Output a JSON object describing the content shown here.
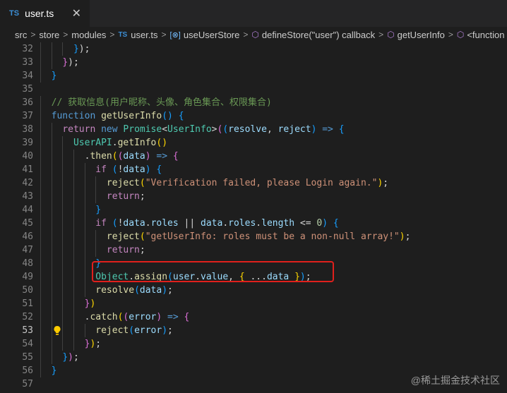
{
  "tab": {
    "badge": "TS",
    "label": "user.ts",
    "close_glyph": "✕"
  },
  "breadcrumb": {
    "items": [
      "src",
      "store",
      "modules",
      "user.ts",
      "useUserStore",
      "defineStore(\"user\") callback",
      "getUserInfo",
      "<function"
    ],
    "ts_badge": "TS",
    "var_icon": "[⊗]",
    "cube_icon": "⬡"
  },
  "colors": {
    "keyword": "#569cd6",
    "control": "#c586c0",
    "function": "#dcdcaa",
    "type": "#4ec9b0",
    "variable": "#9cdcfe",
    "string": "#ce9178",
    "number": "#b5cea8",
    "comment": "#6a9955",
    "highlight": "#e0201c"
  },
  "editor": {
    "active_line": 53,
    "lightbulb_icon": "lightbulb-icon",
    "lines": [
      {
        "n": "32",
        "t": [
          [
            "      ",
            "pn"
          ],
          [
            "}",
            "b3"
          ],
          [
            ");",
            "pn"
          ]
        ]
      },
      {
        "n": "33",
        "t": [
          [
            "    ",
            "pn"
          ],
          [
            "}",
            "b2"
          ],
          [
            ");",
            "pn"
          ]
        ]
      },
      {
        "n": "34",
        "t": [
          [
            "  ",
            "pn"
          ],
          [
            "}",
            "b3"
          ]
        ]
      },
      {
        "n": "35",
        "t": []
      },
      {
        "n": "36",
        "t": [
          [
            "  ",
            "pn"
          ],
          [
            "// 获取信息(用户昵称、头像、角色集合、权限集合)",
            "cm"
          ]
        ]
      },
      {
        "n": "37",
        "t": [
          [
            "  ",
            "pn"
          ],
          [
            "function",
            "kw"
          ],
          [
            " ",
            "pn"
          ],
          [
            "getUserInfo",
            "fn"
          ],
          [
            "()",
            "b3"
          ],
          [
            " ",
            "pn"
          ],
          [
            "{",
            "b3"
          ]
        ]
      },
      {
        "n": "38",
        "t": [
          [
            "    ",
            "pn"
          ],
          [
            "return",
            "ctl"
          ],
          [
            " ",
            "pn"
          ],
          [
            "new",
            "kw"
          ],
          [
            " ",
            "pn"
          ],
          [
            "Promise",
            "ty"
          ],
          [
            "<",
            "pn"
          ],
          [
            "UserInfo",
            "ty"
          ],
          [
            ">",
            "pn"
          ],
          [
            "(",
            "b2"
          ],
          [
            "(",
            "b3"
          ],
          [
            "resolve",
            "vr"
          ],
          [
            ", ",
            "pn"
          ],
          [
            "reject",
            "vr"
          ],
          [
            ")",
            "b3"
          ],
          [
            " => ",
            "kw"
          ],
          [
            "{",
            "b3"
          ]
        ]
      },
      {
        "n": "39",
        "t": [
          [
            "      ",
            "pn"
          ],
          [
            "UserAPI",
            "ty"
          ],
          [
            ".",
            "pn"
          ],
          [
            "getInfo",
            "fn"
          ],
          [
            "()",
            "b1"
          ]
        ]
      },
      {
        "n": "40",
        "t": [
          [
            "        .",
            "pn"
          ],
          [
            "then",
            "fn"
          ],
          [
            "(",
            "b1"
          ],
          [
            "(",
            "b2"
          ],
          [
            "data",
            "vr"
          ],
          [
            ")",
            "b2"
          ],
          [
            " => ",
            "kw"
          ],
          [
            "{",
            "b2"
          ]
        ]
      },
      {
        "n": "41",
        "t": [
          [
            "          ",
            "pn"
          ],
          [
            "if",
            "ctl"
          ],
          [
            " ",
            "pn"
          ],
          [
            "(",
            "b3"
          ],
          [
            "!",
            "pn"
          ],
          [
            "data",
            "vr"
          ],
          [
            ")",
            "b3"
          ],
          [
            " ",
            "pn"
          ],
          [
            "{",
            "b3"
          ]
        ]
      },
      {
        "n": "42",
        "t": [
          [
            "            ",
            "pn"
          ],
          [
            "reject",
            "fn"
          ],
          [
            "(",
            "b1"
          ],
          [
            "\"Verification failed, please Login again.\"",
            "st"
          ],
          [
            ")",
            "b1"
          ],
          [
            ";",
            "pn"
          ]
        ]
      },
      {
        "n": "43",
        "t": [
          [
            "            ",
            "pn"
          ],
          [
            "return",
            "ctl"
          ],
          [
            ";",
            "pn"
          ]
        ]
      },
      {
        "n": "44",
        "t": [
          [
            "          ",
            "pn"
          ],
          [
            "}",
            "b3"
          ]
        ]
      },
      {
        "n": "45",
        "t": [
          [
            "          ",
            "pn"
          ],
          [
            "if",
            "ctl"
          ],
          [
            " ",
            "pn"
          ],
          [
            "(",
            "b3"
          ],
          [
            "!",
            "pn"
          ],
          [
            "data",
            "vr"
          ],
          [
            ".",
            "pn"
          ],
          [
            "roles",
            "vr"
          ],
          [
            " || ",
            "pn"
          ],
          [
            "data",
            "vr"
          ],
          [
            ".",
            "pn"
          ],
          [
            "roles",
            "vr"
          ],
          [
            ".",
            "pn"
          ],
          [
            "length",
            "vr"
          ],
          [
            " <= ",
            "pn"
          ],
          [
            "0",
            "nm"
          ],
          [
            ")",
            "b3"
          ],
          [
            " ",
            "pn"
          ],
          [
            "{",
            "b3"
          ]
        ]
      },
      {
        "n": "46",
        "t": [
          [
            "            ",
            "pn"
          ],
          [
            "reject",
            "fn"
          ],
          [
            "(",
            "b1"
          ],
          [
            "\"getUserInfo: roles must be a non-null array!\"",
            "st"
          ],
          [
            ")",
            "b1"
          ],
          [
            ";",
            "pn"
          ]
        ]
      },
      {
        "n": "47",
        "t": [
          [
            "            ",
            "pn"
          ],
          [
            "return",
            "ctl"
          ],
          [
            ";",
            "pn"
          ]
        ]
      },
      {
        "n": "48",
        "t": [
          [
            "          ",
            "pn"
          ],
          [
            "}",
            "b3"
          ]
        ]
      },
      {
        "n": "49",
        "t": [
          [
            "          ",
            "pn"
          ],
          [
            "Object",
            "ty"
          ],
          [
            ".",
            "pn"
          ],
          [
            "assign",
            "fn"
          ],
          [
            "(",
            "b3"
          ],
          [
            "user",
            "vr"
          ],
          [
            ".",
            "pn"
          ],
          [
            "value",
            "vr"
          ],
          [
            ", ",
            "pn"
          ],
          [
            "{",
            "b1"
          ],
          [
            " ...",
            "pn"
          ],
          [
            "data",
            "vr"
          ],
          [
            " ",
            "pn"
          ],
          [
            "}",
            "b1"
          ],
          [
            ")",
            "b3"
          ],
          [
            ";",
            "pn"
          ]
        ]
      },
      {
        "n": "50",
        "t": [
          [
            "          ",
            "pn"
          ],
          [
            "resolve",
            "fn"
          ],
          [
            "(",
            "b3"
          ],
          [
            "data",
            "vr"
          ],
          [
            ")",
            "b3"
          ],
          [
            ";",
            "pn"
          ]
        ]
      },
      {
        "n": "51",
        "t": [
          [
            "        ",
            "pn"
          ],
          [
            "}",
            "b2"
          ],
          [
            ")",
            "b1"
          ]
        ]
      },
      {
        "n": "52",
        "t": [
          [
            "        .",
            "pn"
          ],
          [
            "catch",
            "fn"
          ],
          [
            "(",
            "b1"
          ],
          [
            "(",
            "b2"
          ],
          [
            "error",
            "vr"
          ],
          [
            ")",
            "b2"
          ],
          [
            " => ",
            "kw"
          ],
          [
            "{",
            "b2"
          ]
        ]
      },
      {
        "n": "53",
        "t": [
          [
            "          ",
            "pn"
          ],
          [
            "reject",
            "fn"
          ],
          [
            "(",
            "b3"
          ],
          [
            "error",
            "vr"
          ],
          [
            ")",
            "b3"
          ],
          [
            ";",
            "pn"
          ]
        ]
      },
      {
        "n": "54",
        "t": [
          [
            "        ",
            "pn"
          ],
          [
            "}",
            "b2"
          ],
          [
            ")",
            "b1"
          ],
          [
            ";",
            "pn"
          ]
        ]
      },
      {
        "n": "55",
        "t": [
          [
            "    ",
            "pn"
          ],
          [
            "}",
            "b3"
          ],
          [
            ")",
            "b2"
          ],
          [
            ";",
            "pn"
          ]
        ]
      },
      {
        "n": "56",
        "t": [
          [
            "  ",
            "pn"
          ],
          [
            "}",
            "b3"
          ]
        ]
      },
      {
        "n": "57",
        "t": []
      }
    ]
  },
  "watermark": "@稀土掘金技术社区"
}
